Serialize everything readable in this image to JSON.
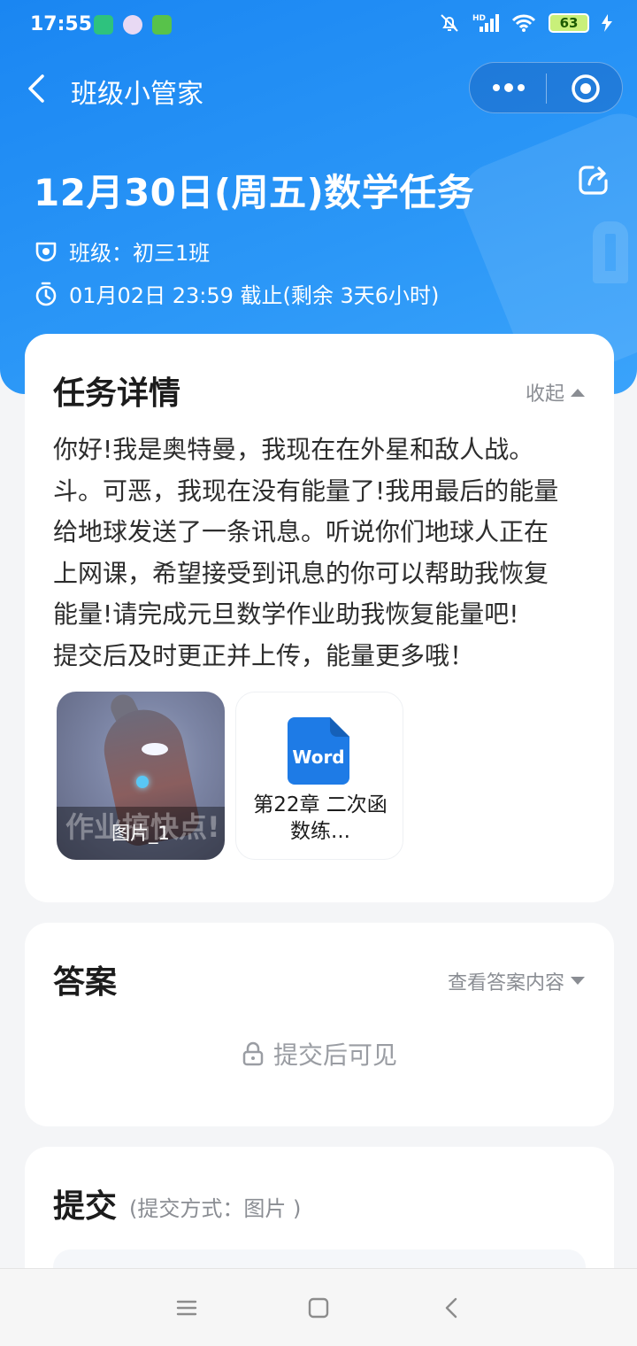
{
  "status_bar": {
    "time": "17:55",
    "battery": "63",
    "network": "HD"
  },
  "nav": {
    "title": "班级小管家"
  },
  "task": {
    "title": "12月30日(周五)数学任务",
    "class_label": "班级：初三1班",
    "deadline": "01月02日 23:59 截止(剩余 3天6小时)"
  },
  "details": {
    "title": "任务详情",
    "collapse_label": "收起",
    "description": "你好!我是奥特曼，我现在在外星和敌人战。\n斗。可恶，我现在没有能量了!我用最后的能量\n给地球发送了一条讯息。听说你们地球人正在\n上网课，希望接受到讯息的你可以帮助我恢复\n能量!请完成元旦数学作业助我恢复能量吧!\n提交后及时更正并上传，能量更多哦！",
    "attachments": [
      {
        "type": "image",
        "overlay_text": "作业搞快点!",
        "caption": "图片_1"
      },
      {
        "type": "word",
        "icon_label": "Word",
        "name": "第22章 二次函数练..."
      }
    ]
  },
  "answer": {
    "title": "答案",
    "view_label": "查看答案内容",
    "locked_text": "提交后可见"
  },
  "submit": {
    "title": "提交",
    "mode": "(提交方式：图片 )"
  },
  "colors": {
    "hero_blue": "#1a86f2",
    "word_blue": "#1e7be6"
  }
}
